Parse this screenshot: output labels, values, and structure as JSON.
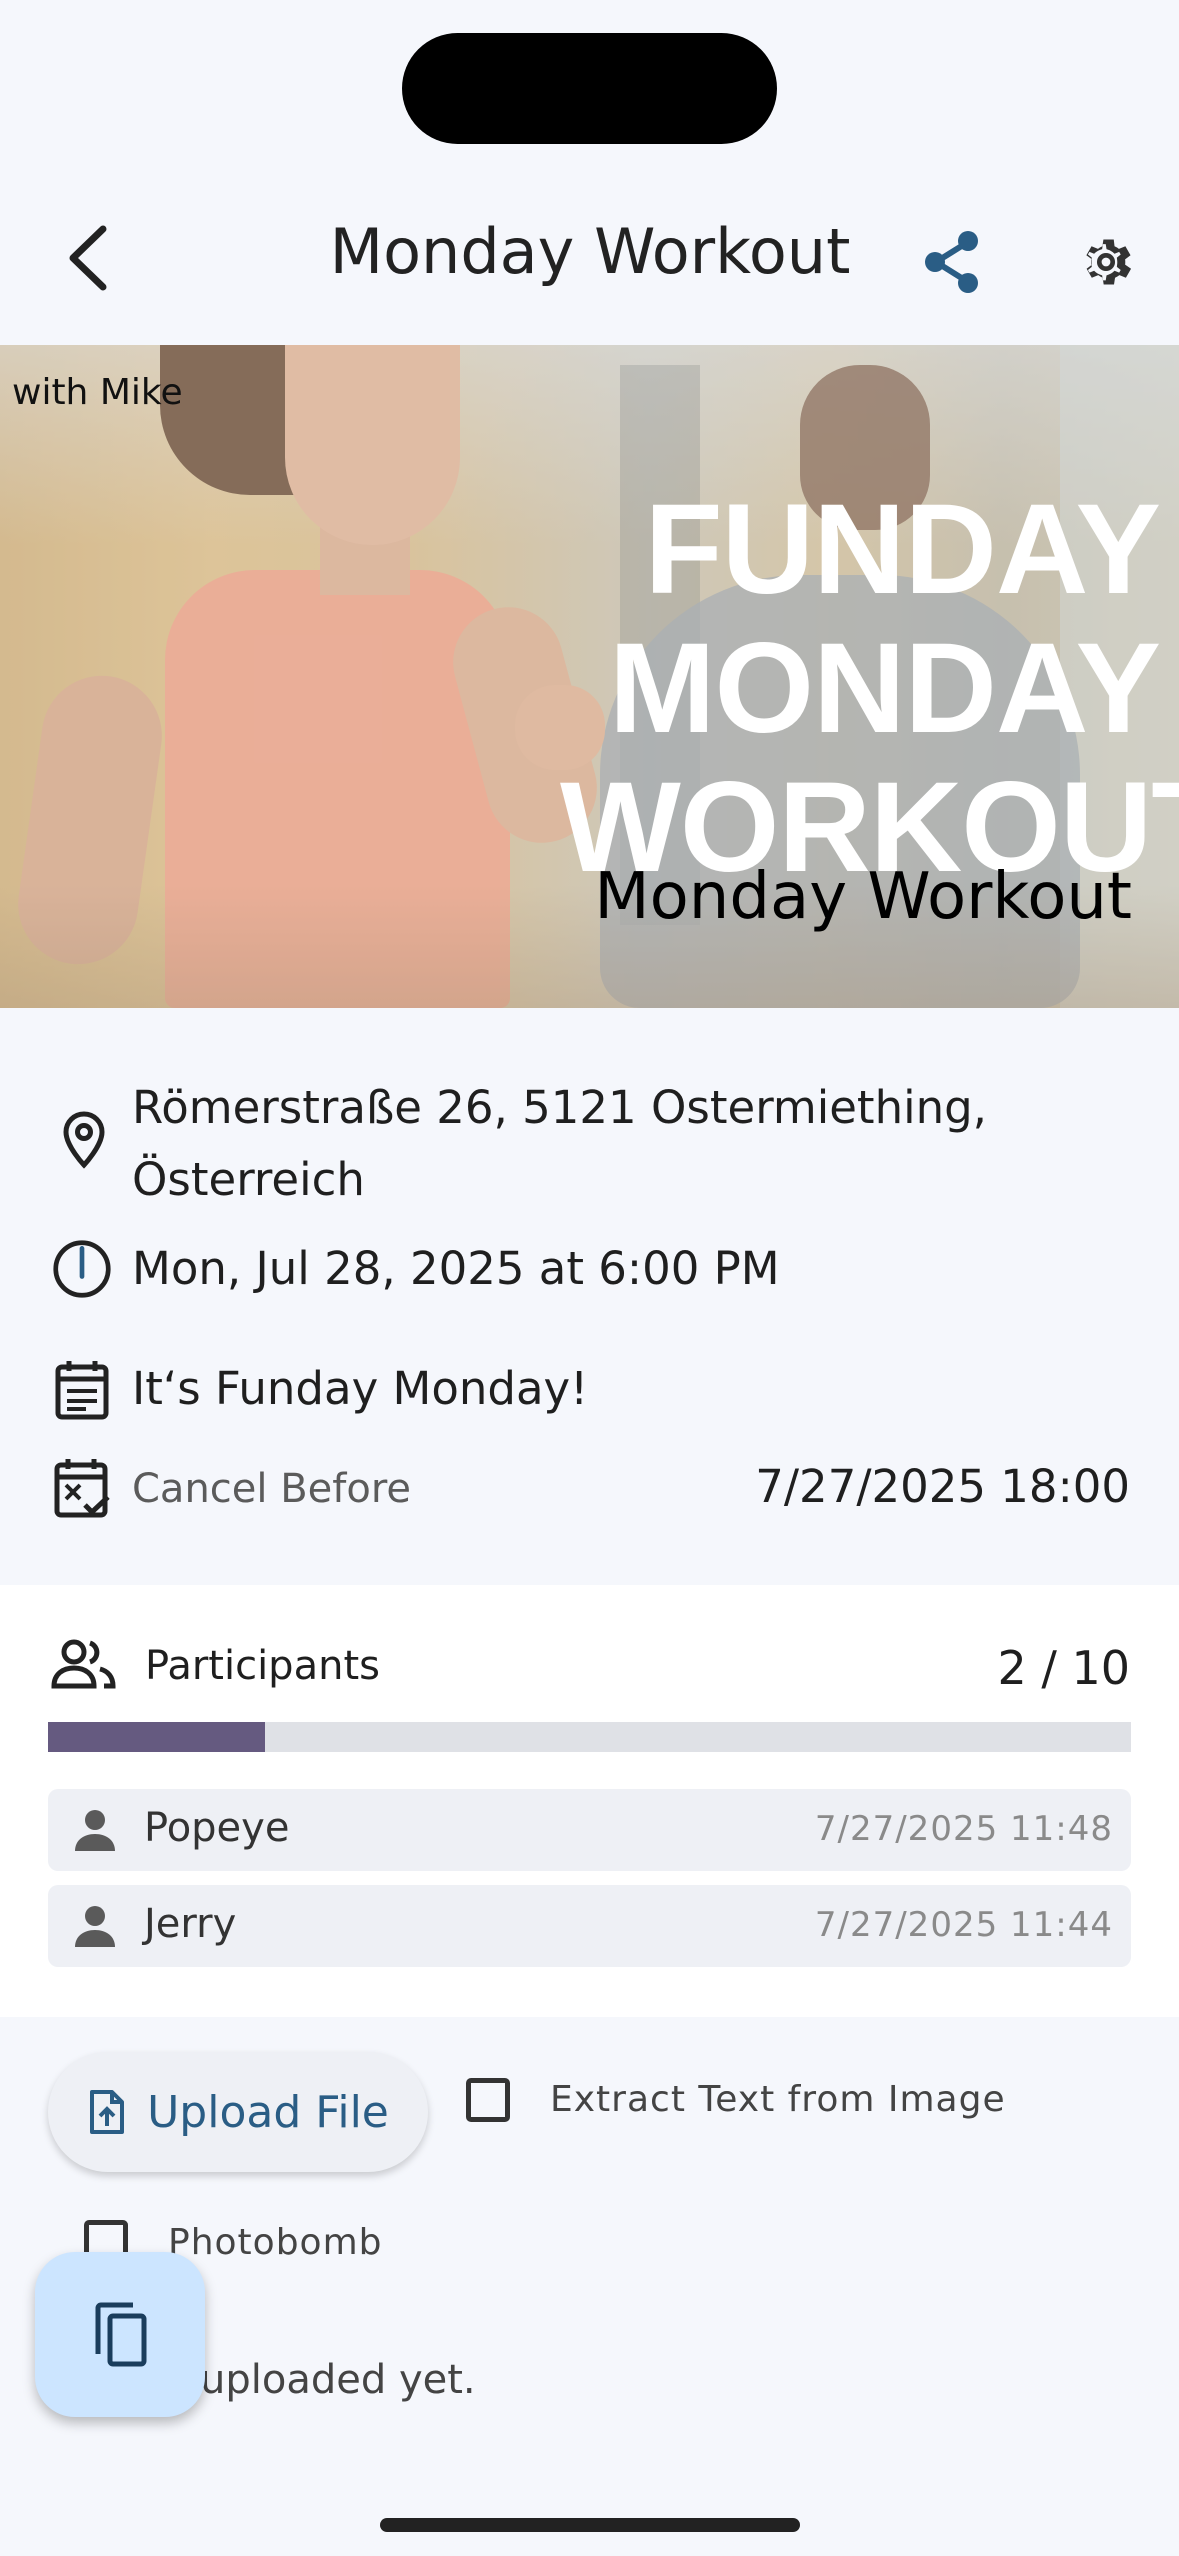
{
  "header": {
    "title": "Monday Workout"
  },
  "hero": {
    "tag": "with Mike",
    "headline_lines": [
      "FUNDAY",
      "MONDAY",
      "WORKOUT"
    ],
    "caption": "Monday Workout"
  },
  "details": {
    "address_line1": "Römerstraße 26, 5121 Ostermiething,",
    "address_line2": "Österreich",
    "datetime": "Mon, Jul 28, 2025 at 6:00 PM",
    "description": "It‘s Funday Monday!",
    "cancel_label": "Cancel Before",
    "cancel_value": "7/27/2025 18:00"
  },
  "participants": {
    "label": "Participants",
    "count": "2 / 10",
    "fill_fraction": 0.2,
    "list": [
      {
        "name": "Popeye",
        "time": "7/27/2025 11:48"
      },
      {
        "name": "Jerry",
        "time": "7/27/2025 11:44"
      }
    ]
  },
  "uploads": {
    "upload_label": "Upload File",
    "extract_label": "Extract Text from Image",
    "photobomb_label": "Photobomb",
    "empty_text": "uploaded yet."
  },
  "colors": {
    "accent": "#2a5d85",
    "progress": "#655a80",
    "fab": "#cce5ff"
  },
  "icons": {
    "back": "chevron-left-icon",
    "share": "share-icon",
    "settings": "gear-icon",
    "location": "map-pin-icon",
    "time": "clock-icon",
    "description": "calendar-notes-icon",
    "cancel": "calendar-x-icon",
    "participants": "people-icon",
    "person": "person-icon",
    "upload": "file-upload-icon",
    "fab": "copy-icon"
  }
}
